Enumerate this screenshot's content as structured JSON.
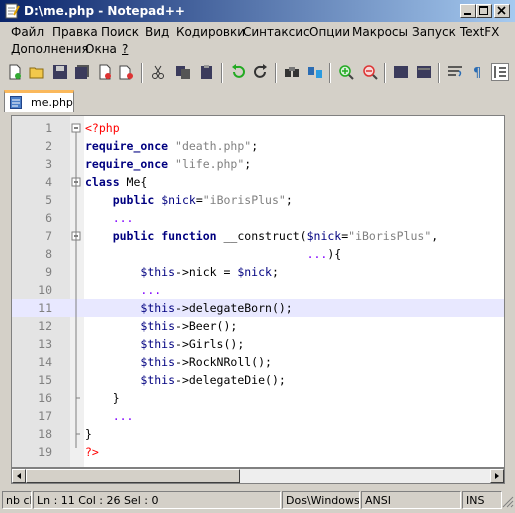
{
  "window": {
    "title": "D:\\me.php - Notepad++",
    "app_icon": "notepad-icon"
  },
  "menu": {
    "row1": [
      "Файл",
      "Правка",
      "Поиск",
      "Вид",
      "Кодировки",
      "Синтаксис",
      "Опции",
      "Макросы",
      "Запуск",
      "TextFX"
    ],
    "row2": [
      "Дополнения",
      "Окна",
      "?"
    ]
  },
  "toolbar": {
    "icons": [
      "new-file-icon",
      "open-folder-icon",
      "save-icon",
      "save-all-icon",
      "close-icon",
      "close-all-icon",
      "print-icon",
      "cut-icon",
      "copy-icon",
      "paste-icon",
      "undo-icon",
      "redo-icon",
      "find-icon",
      "replace-icon",
      "zoom-in-icon",
      "zoom-out-icon",
      "sync-v-icon",
      "sync-h-icon",
      "word-wrap-icon",
      "show-all-chars-icon",
      "indent-guide-icon"
    ]
  },
  "tab": {
    "label": "me.php",
    "icon": "php-file-icon"
  },
  "editor": {
    "current_line": 11,
    "lines": [
      {
        "num": "1",
        "tokens": [
          {
            "c": "php",
            "t": "<?php"
          }
        ]
      },
      {
        "num": "2",
        "tokens": [
          {
            "c": "kw",
            "t": "require_once"
          },
          {
            "c": "",
            "t": " "
          },
          {
            "c": "str",
            "t": "\"death.php\""
          },
          {
            "c": "",
            "t": ";"
          }
        ]
      },
      {
        "num": "3",
        "tokens": [
          {
            "c": "kw",
            "t": "require_once"
          },
          {
            "c": "",
            "t": " "
          },
          {
            "c": "str",
            "t": "\"life.php\""
          },
          {
            "c": "",
            "t": ";"
          }
        ]
      },
      {
        "num": "4",
        "tokens": [
          {
            "c": "kw",
            "t": "class"
          },
          {
            "c": "",
            "t": " Me{"
          }
        ]
      },
      {
        "num": "5",
        "tokens": [
          {
            "c": "",
            "t": "    "
          },
          {
            "c": "kw",
            "t": "public"
          },
          {
            "c": "",
            "t": " "
          },
          {
            "c": "var",
            "t": "$nick"
          },
          {
            "c": "",
            "t": "="
          },
          {
            "c": "str",
            "t": "\"iBorisPlus\""
          },
          {
            "c": "",
            "t": ";"
          }
        ]
      },
      {
        "num": "6",
        "tokens": [
          {
            "c": "",
            "t": "    "
          },
          {
            "c": "op",
            "t": "..."
          }
        ]
      },
      {
        "num": "7",
        "tokens": [
          {
            "c": "",
            "t": "    "
          },
          {
            "c": "kw",
            "t": "public"
          },
          {
            "c": "",
            "t": " "
          },
          {
            "c": "kw",
            "t": "function"
          },
          {
            "c": "",
            "t": " __construct("
          },
          {
            "c": "var",
            "t": "$nick"
          },
          {
            "c": "",
            "t": "="
          },
          {
            "c": "str",
            "t": "\"iBorisPlus\""
          },
          {
            "c": "",
            "t": ","
          }
        ]
      },
      {
        "num": "8",
        "tokens": [
          {
            "c": "",
            "t": "                                "
          },
          {
            "c": "op",
            "t": "..."
          },
          {
            "c": "",
            "t": "){"
          }
        ]
      },
      {
        "num": "9",
        "tokens": [
          {
            "c": "",
            "t": "        "
          },
          {
            "c": "var",
            "t": "$this"
          },
          {
            "c": "",
            "t": "->nick = "
          },
          {
            "c": "var",
            "t": "$nick"
          },
          {
            "c": "",
            "t": ";"
          }
        ]
      },
      {
        "num": "10",
        "tokens": [
          {
            "c": "",
            "t": "        "
          },
          {
            "c": "op",
            "t": "..."
          }
        ]
      },
      {
        "num": "11",
        "tokens": [
          {
            "c": "",
            "t": "        "
          },
          {
            "c": "var",
            "t": "$this"
          },
          {
            "c": "",
            "t": "->delegateBorn();"
          }
        ]
      },
      {
        "num": "12",
        "tokens": [
          {
            "c": "",
            "t": "        "
          },
          {
            "c": "var",
            "t": "$this"
          },
          {
            "c": "",
            "t": "->Beer();"
          }
        ]
      },
      {
        "num": "13",
        "tokens": [
          {
            "c": "",
            "t": "        "
          },
          {
            "c": "var",
            "t": "$this"
          },
          {
            "c": "",
            "t": "->Girls();"
          }
        ]
      },
      {
        "num": "14",
        "tokens": [
          {
            "c": "",
            "t": "        "
          },
          {
            "c": "var",
            "t": "$this"
          },
          {
            "c": "",
            "t": "->RockNRoll();"
          }
        ]
      },
      {
        "num": "15",
        "tokens": [
          {
            "c": "",
            "t": "        "
          },
          {
            "c": "var",
            "t": "$this"
          },
          {
            "c": "",
            "t": "->delegateDie();"
          }
        ]
      },
      {
        "num": "16",
        "tokens": [
          {
            "c": "",
            "t": "    }"
          }
        ]
      },
      {
        "num": "17",
        "tokens": [
          {
            "c": "",
            "t": "    "
          },
          {
            "c": "op",
            "t": "..."
          }
        ]
      },
      {
        "num": "18",
        "tokens": [
          {
            "c": "",
            "t": "}"
          }
        ]
      },
      {
        "num": "19",
        "tokens": [
          {
            "c": "php",
            "t": "?>"
          }
        ]
      }
    ],
    "fold_markers": [
      1,
      4,
      7
    ]
  },
  "statusbar": {
    "type": "nb ch",
    "position": "Ln : 11    Col : 26    Sel : 0",
    "eol": "Dos\\Windows",
    "encoding": "ANSI",
    "mode": "INS"
  },
  "colors": {
    "title_start": "#0a246a",
    "title_end": "#a6caf0",
    "keyword": "#000080",
    "string": "#808080",
    "php_tag": "#ff0000",
    "current_line": "#e8e8ff"
  }
}
